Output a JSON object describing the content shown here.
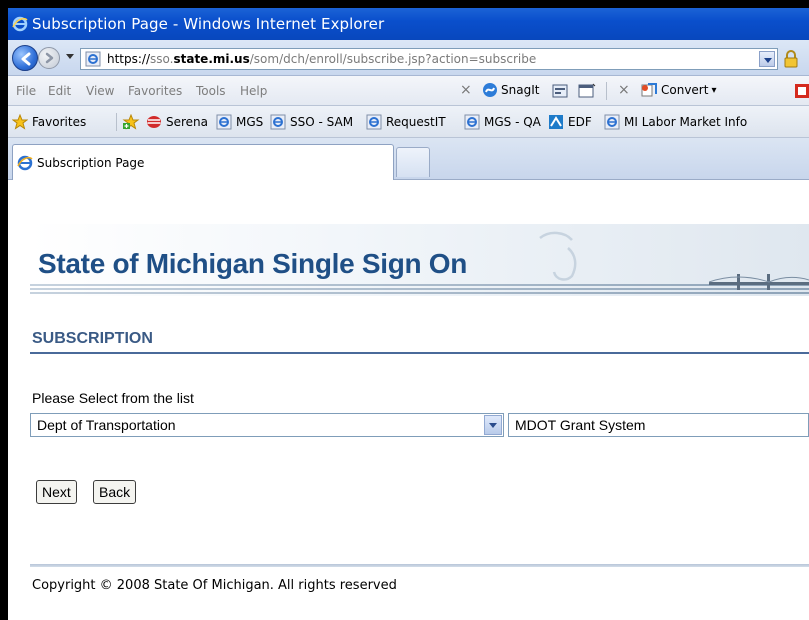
{
  "window": {
    "title": "Subscription Page - Windows Internet Explorer"
  },
  "address_bar": {
    "url_scheme": "https://",
    "url_host_prefix": "sso.",
    "url_host_bold": "state.mi.us",
    "url_path": "/som/dch/enroll/subscribe.jsp?action=subscribe"
  },
  "menu": {
    "items": [
      "File",
      "Edit",
      "View",
      "Favorites",
      "Tools",
      "Help"
    ]
  },
  "toolbar": {
    "snagit_label": "SnagIt",
    "convert_label": "Convert"
  },
  "favorites_bar": {
    "favorites_label": "Favorites",
    "links": [
      "Serena",
      "MGS",
      "SSO - SAM",
      "RequestIT",
      "MGS - QA",
      "EDF",
      "MI Labor Market Info"
    ]
  },
  "tabs": {
    "active_tab_label": "Subscription Page"
  },
  "page": {
    "banner_title": "State of Michigan Single Sign On",
    "section_title": "SUBSCRIPTION",
    "prompt": "Please Select from the list",
    "department_select_value": "Dept of Transportation",
    "system_select_value": "MDOT Grant System",
    "next_label": "Next",
    "back_label": "Back",
    "footer": "Copyright © 2008 State Of Michigan. All rights reserved"
  },
  "colors": {
    "titlebar": "#0a4fcc",
    "banner_text": "#1f4f86",
    "section_text": "#3a5a85",
    "section_rule": "#4a6a9a"
  },
  "icons": [
    "ie-icon",
    "back-arrow-icon",
    "forward-arrow-icon",
    "lock-icon",
    "star-icon",
    "add-favorite-icon",
    "serena-icon",
    "ie-page-icon",
    "edf-icon",
    "snagit-icon",
    "convert-icon",
    "close-icon"
  ]
}
